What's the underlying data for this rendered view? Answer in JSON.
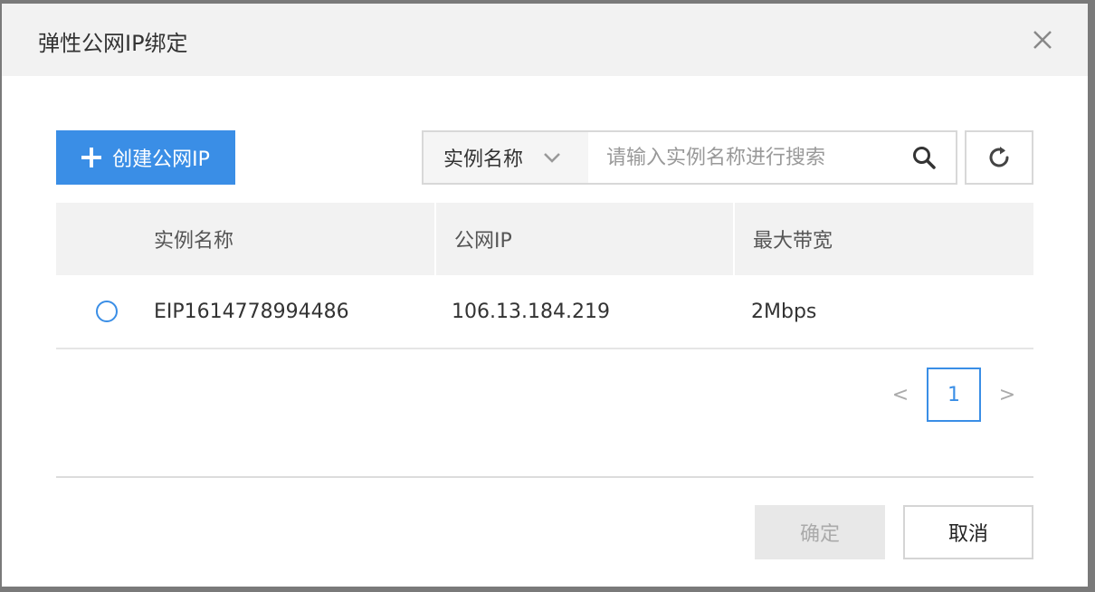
{
  "dialog": {
    "title": "弹性公网IP绑定",
    "close_icon": "close-icon"
  },
  "toolbar": {
    "create_label": "创建公网IP",
    "create_icon": "plus-icon",
    "search": {
      "field_selected": "实例名称",
      "placeholder": "请输入实例名称进行搜索",
      "search_icon": "search-icon"
    },
    "refresh_icon": "refresh-icon"
  },
  "table": {
    "columns": [
      "实例名称",
      "公网IP",
      "最大带宽"
    ],
    "rows": [
      {
        "name": "EIP1614778994486",
        "ip": "106.13.184.219",
        "bandwidth": "2Mbps",
        "selected": false
      }
    ]
  },
  "pagination": {
    "prev": "<",
    "current": "1",
    "next": ">"
  },
  "footer": {
    "confirm_label": "确定",
    "cancel_label": "取消"
  },
  "colors": {
    "accent": "#3a8ee6",
    "header_bg": "#f2f2f2",
    "disabled_bg": "#e8e8e8"
  }
}
